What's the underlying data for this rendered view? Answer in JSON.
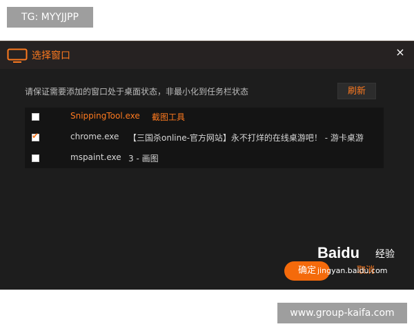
{
  "watermarks": {
    "top_tag": "TG: MYYJJPP",
    "bottom_tag": "www.group-kaifa.com",
    "baidu_logo": "Baidu",
    "baidu_sub": "经验",
    "baidu_url": "jingyan.baidu.com"
  },
  "dialog": {
    "title": "选择窗口",
    "title_icon": "monitor-icon",
    "close_label": "×",
    "hint": "请保证需要添加的窗口处于桌面状态，非最小化到任务栏状态",
    "refresh_label": "刷新",
    "ok_label": "确定",
    "cancel_label": "取消",
    "accent_color": "#ff7a1f",
    "windows": [
      {
        "process": "SnippingTool.exe",
        "title": "截图工具",
        "checked": false,
        "highlighted": true
      },
      {
        "process": "chrome.exe",
        "title": "【三国杀online-官方网站】永不打烊的在线桌游吧！ - 游卡桌游",
        "checked": true,
        "highlighted": false
      },
      {
        "process": "mspaint.exe",
        "title": "3 - 画图",
        "checked": false,
        "highlighted": false
      }
    ]
  }
}
